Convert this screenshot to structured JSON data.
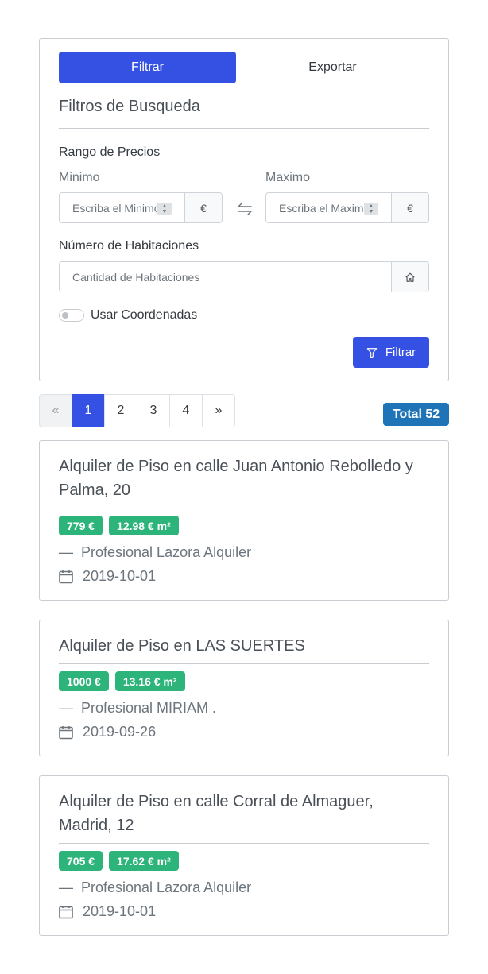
{
  "tabs": {
    "filter_label": "Filtrar",
    "export_label": "Exportar"
  },
  "filters": {
    "title": "Filtros de Busqueda",
    "price_range_label": "Rango de Precios",
    "min_label": "Minimo",
    "max_label": "Maximo",
    "min_placeholder": "Escriba el Minimo",
    "max_placeholder": "Escriba el Maximo",
    "currency": "€",
    "rooms_label": "Número de Habitaciones",
    "rooms_placeholder": "Cantidad de Habitaciones",
    "coords_label": "Usar Coordenadas",
    "coords_enabled": false,
    "submit_label": "Filtrar"
  },
  "pagination": {
    "prev": "«",
    "pages": [
      "1",
      "2",
      "3",
      "4"
    ],
    "next": "»",
    "current": "1"
  },
  "total_label": "Total 52",
  "listings": [
    {
      "title": "Alquiler de Piso en calle Juan Antonio Rebolledo y Palma, 20",
      "price": "779  €",
      "price_m2": "12.98  €  m²",
      "agent": "Profesional Lazora Alquiler",
      "date": "2019-10-01"
    },
    {
      "title": "Alquiler de Piso en LAS SUERTES",
      "price": "1000  €",
      "price_m2": "13.16  €  m²",
      "agent": "Profesional MIRIAM .",
      "date": "2019-09-26"
    },
    {
      "title": "Alquiler de Piso en calle Corral de Almaguer, Madrid, 12",
      "price": "705  €",
      "price_m2": "17.62  €  m²",
      "agent": "Profesional Lazora Alquiler",
      "date": "2019-10-01"
    }
  ],
  "colors": {
    "primary": "#3451e3",
    "success": "#2db47a",
    "info": "#1f73b7"
  }
}
